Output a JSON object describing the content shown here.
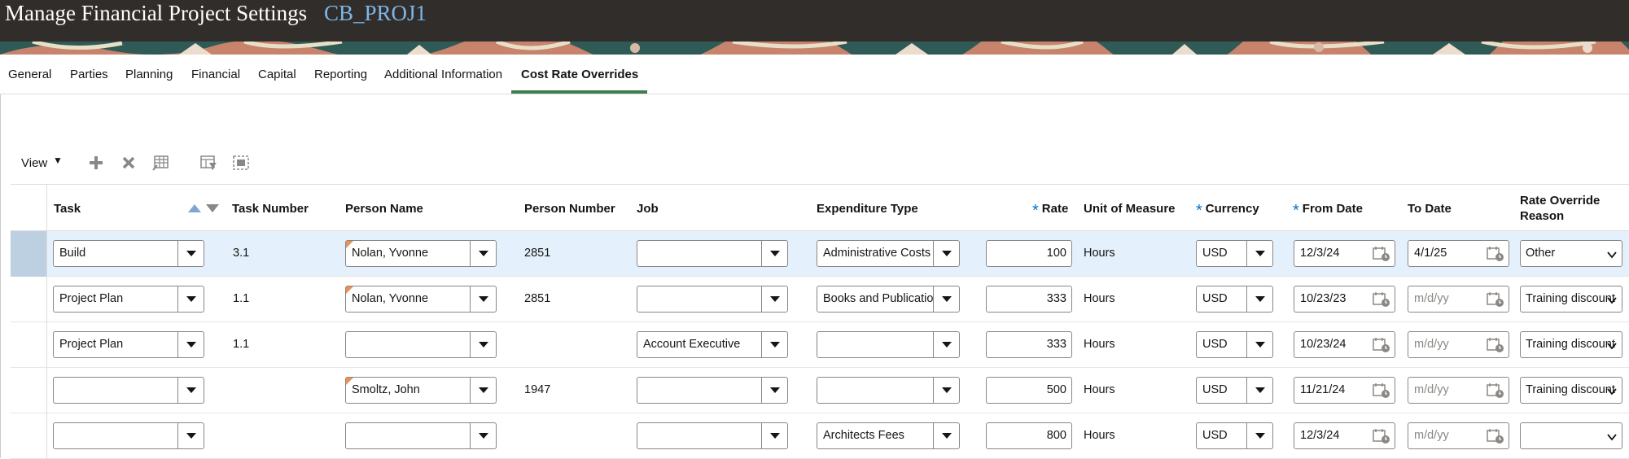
{
  "header": {
    "title": "Manage Financial Project Settings",
    "project": "CB_PROJ1"
  },
  "tabs": [
    {
      "label": "General"
    },
    {
      "label": "Parties"
    },
    {
      "label": "Planning"
    },
    {
      "label": "Financial"
    },
    {
      "label": "Capital"
    },
    {
      "label": "Reporting"
    },
    {
      "label": "Additional Information"
    },
    {
      "label": "Cost Rate Overrides",
      "active": true
    }
  ],
  "toolbar": {
    "view_label": "View",
    "icons": [
      "add-icon",
      "delete-icon",
      "edit-columns-icon",
      "query-by-example-icon",
      "detach-icon"
    ]
  },
  "columns": {
    "task": "Task",
    "task_number": "Task Number",
    "person_name": "Person Name",
    "person_number": "Person Number",
    "job": "Job",
    "expenditure_type": "Expenditure Type",
    "rate": "Rate",
    "unit_of_measure": "Unit of Measure",
    "currency": "Currency",
    "from_date": "From Date",
    "to_date": "To Date",
    "rate_override_reason_1": "Rate Override",
    "rate_override_reason_2": "Reason",
    "required_marker": "*"
  },
  "rows": [
    {
      "task": "Build",
      "task_number": "3.1",
      "person_name": "Nolan, Yvonne",
      "person_number": "2851",
      "job": "",
      "expenditure_type": "Administrative Costs",
      "rate": "100",
      "uom": "Hours",
      "currency": "USD",
      "from_date": "12/3/24",
      "to_date": "4/1/25",
      "reason": "Other",
      "selected": true
    },
    {
      "task": "Project Plan",
      "task_number": "1.1",
      "person_name": "Nolan, Yvonne",
      "person_number": "2851",
      "job": "",
      "expenditure_type": "Books and Publications",
      "rate": "333",
      "uom": "Hours",
      "currency": "USD",
      "from_date": "10/23/23",
      "to_date": "",
      "reason": "Training discount"
    },
    {
      "task": "Project Plan",
      "task_number": "1.1",
      "person_name": "",
      "person_number": "",
      "job": "Account Executive",
      "expenditure_type": "",
      "rate": "333",
      "uom": "Hours",
      "currency": "USD",
      "from_date": "10/23/24",
      "to_date": "",
      "reason": "Training discount"
    },
    {
      "task": "",
      "task_number": "",
      "person_name": "Smoltz, John",
      "person_number": "1947",
      "job": "",
      "expenditure_type": "",
      "rate": "500",
      "uom": "Hours",
      "currency": "USD",
      "from_date": "11/21/24",
      "to_date": "",
      "reason": "Training discount"
    },
    {
      "task": "",
      "task_number": "",
      "person_name": "",
      "person_number": "",
      "job": "",
      "expenditure_type": "Architects Fees",
      "rate": "800",
      "uom": "Hours",
      "currency": "USD",
      "from_date": "12/3/24",
      "to_date": "",
      "reason": ""
    }
  ],
  "date_placeholder": "m/d/yy",
  "colors": {
    "titlebar": "#312d2a",
    "project_accent": "#7eb6e8",
    "tab_underline": "#3f7f4f",
    "selected_row": "#e4f0fb",
    "required": "#0572ce"
  }
}
